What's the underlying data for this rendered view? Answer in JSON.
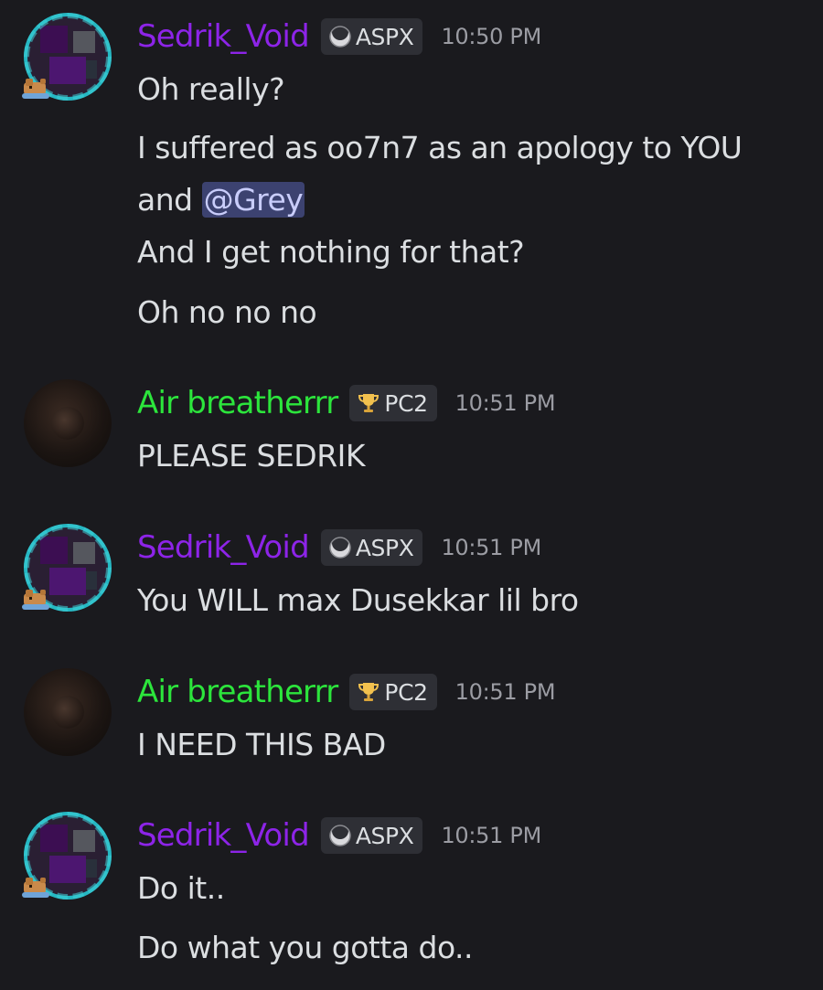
{
  "users": {
    "sedrik": {
      "name": "Sedrik_Void",
      "tag": "ASPX",
      "tag_icon": "moon-icon",
      "color": "#8d24e8",
      "avatar": "pixel-purple-avatar"
    },
    "air": {
      "name": "Air breatherrr",
      "tag": "PC2",
      "tag_icon": "trophy-icon",
      "color": "#2ce53c",
      "avatar": "dark-avatar"
    }
  },
  "messages": [
    {
      "author": "Sedrik_Void",
      "tag": "ASPX",
      "time": "10:50 PM",
      "lines": [
        "Oh really?",
        "I suffered as oo7n7 as an apology to YOU",
        "and ",
        "And I get nothing for that?",
        "Oh no no no"
      ],
      "mention": "@Grey"
    },
    {
      "author": "Air breatherrr",
      "tag": "PC2",
      "time": "10:51 PM",
      "lines": [
        "PLEASE SEDRIK"
      ]
    },
    {
      "author": "Sedrik_Void",
      "tag": "ASPX",
      "time": "10:51 PM",
      "lines": [
        "You WILL max Dusekkar lil bro"
      ]
    },
    {
      "author": "Air breatherrr",
      "tag": "PC2",
      "time": "10:51 PM",
      "lines": [
        "I NEED THIS BAD"
      ]
    },
    {
      "author": "Sedrik_Void",
      "tag": "ASPX",
      "time": "10:51 PM",
      "lines": [
        "Do it..",
        "Do what you gotta do.."
      ]
    }
  ],
  "colors": {
    "background": "#1a1a1e",
    "text": "#dbdee1",
    "timestamp": "#9b9ca3",
    "tag_bg": "#2e2f35",
    "mention_bg": "#3c4270"
  }
}
